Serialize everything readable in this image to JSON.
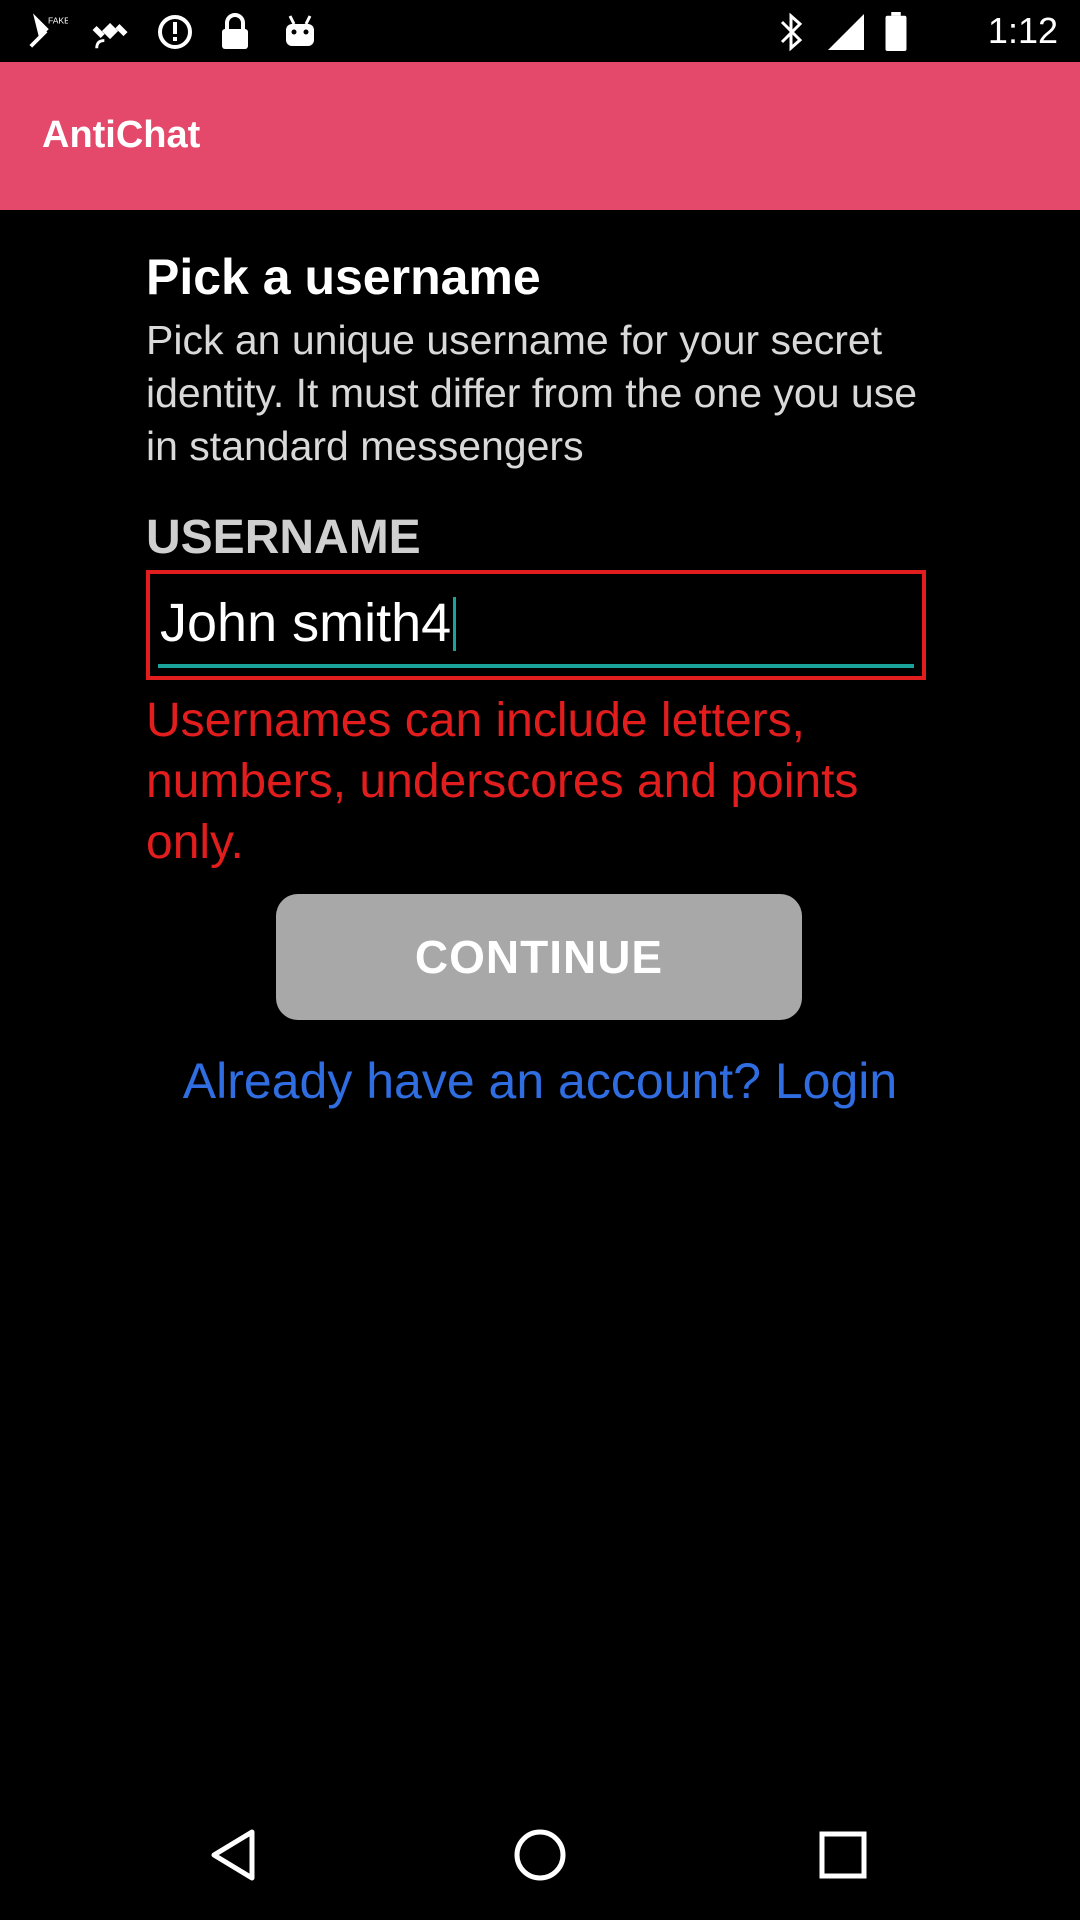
{
  "status_bar": {
    "time": "1:12",
    "icons": [
      "fake-gps-icon",
      "satellite-icon",
      "data-saver-icon",
      "lock-icon",
      "android-icon",
      "bluetooth-icon",
      "signal-icon",
      "battery-icon"
    ]
  },
  "app_bar": {
    "title": "AntiChat",
    "color": "#e4486a"
  },
  "form": {
    "heading": "Pick a username",
    "subtitle": "Pick an unique username for your secret identity. It must differ from the one you use in standard messengers",
    "field_label": "USERNAME",
    "username_value": "John smith4",
    "error_message": "Usernames can include letters, numbers, underscores and points only.",
    "error_color": "#e11d1d",
    "continue_label": "CONTINUE",
    "login_link": "Already have an account? Login",
    "link_color": "#2f6de0"
  },
  "nav_bar": {
    "buttons": [
      "back-icon",
      "home-icon",
      "recents-icon"
    ]
  }
}
